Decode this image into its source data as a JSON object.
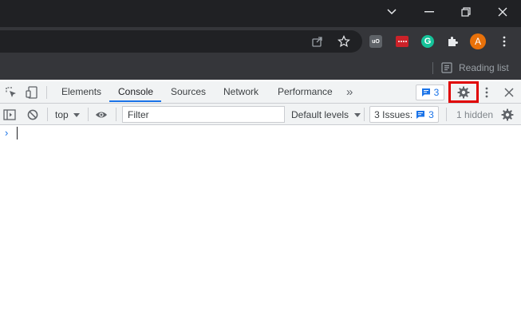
{
  "browser": {
    "window_controls": [
      "chevron-down-icon",
      "minimize-icon",
      "restore-icon",
      "close-icon"
    ],
    "toolbar": {
      "icons": [
        "share-icon",
        "star-icon"
      ],
      "extensions": [
        {
          "name": "ublock-icon",
          "label": "uO"
        },
        {
          "name": "lastpass-icon",
          "label": ""
        },
        {
          "name": "grammarly-icon",
          "label": "G"
        },
        {
          "name": "puzzle-icon",
          "label": ""
        }
      ],
      "avatar_letter": "A"
    },
    "bookmarks_bar": {
      "reading_list_label": "Reading list"
    }
  },
  "devtools": {
    "tabs": [
      {
        "label": "Elements",
        "active": false
      },
      {
        "label": "Console",
        "active": true
      },
      {
        "label": "Sources",
        "active": false
      },
      {
        "label": "Network",
        "active": false
      },
      {
        "label": "Performance",
        "active": false
      }
    ],
    "more_tabs_label": "»",
    "message_count": "3",
    "console_toolbar": {
      "context_label": "top",
      "filter_value": "",
      "filter_placeholder": "Filter",
      "levels_label": "Default levels",
      "issues_label": "3 Issues:",
      "issues_count": "3",
      "hidden_label": "1 hidden"
    },
    "console_prompt": "›"
  },
  "colors": {
    "titlebar": "#202124",
    "toolbar": "#35363a",
    "devtools_bar": "#f1f3f4",
    "accent": "#1a73e8",
    "highlight_box": "#e00000",
    "avatar": "#e8710a"
  }
}
